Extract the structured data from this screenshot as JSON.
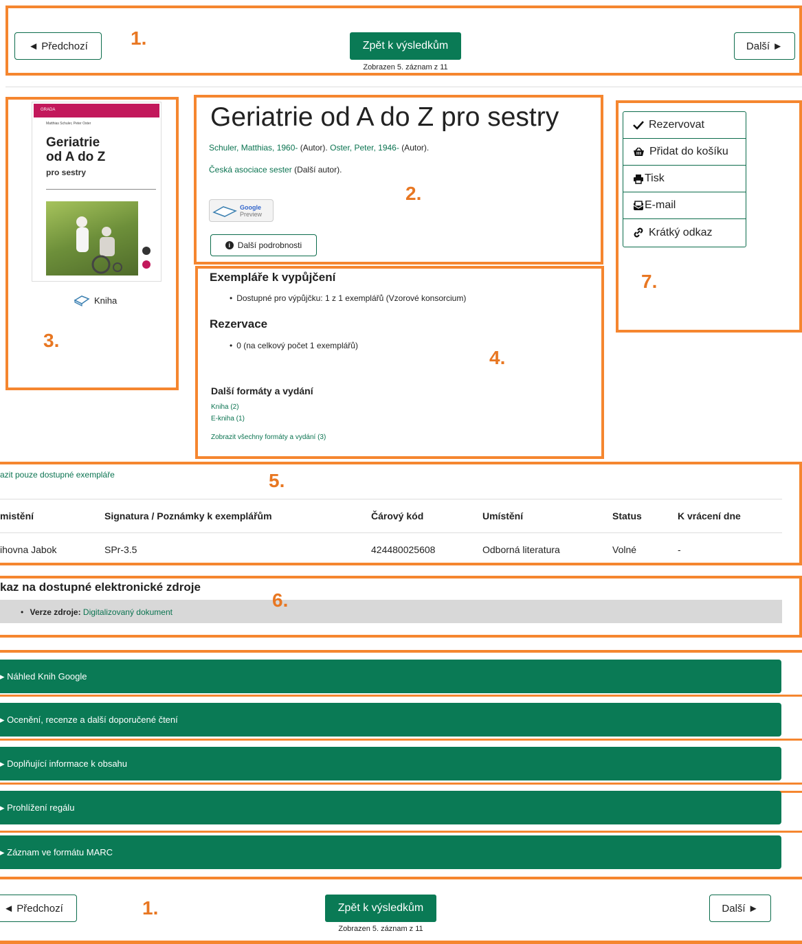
{
  "nav_top": {
    "prev_label": "◄ Předchozí",
    "back_label": "Zpět k výsledkům",
    "next_label": "Další ►",
    "status": "Zobrazen 5. záznam z 11"
  },
  "nav_bottom": {
    "prev_label": "◄ Předchozí",
    "back_label": "Zpět k výsledkům",
    "next_label": "Další ►",
    "status": "Zobrazen 5. záznam z 11"
  },
  "annotations": {
    "n1": "1.",
    "n2": "2.",
    "n3": "3.",
    "n4": "4.",
    "n5": "5.",
    "n6": "6.",
    "n7": "7.",
    "n1b": "1."
  },
  "cover": {
    "authors": "Matthias Schuler, Peter Oster",
    "title_line1": "Geriatrie",
    "title_line2": "od A do Z",
    "subtitle": "pro sestry",
    "publisher": "GRADA",
    "format_label": "Kniha"
  },
  "record": {
    "title": "Geriatrie od A do Z pro sestry",
    "author1": "Schuler, Matthias, 1960-",
    "author1_role": "(Autor).",
    "author2": "Oster, Peter, 1946-",
    "author2_role": "(Autor).",
    "corp_author": "Česká asociace sester",
    "corp_role": "(Další autor).",
    "google_preview_line1": "Google",
    "google_preview_line2": "Preview",
    "more_details": "Další podrobnosti"
  },
  "availability": {
    "heading": "Exempláře k vypůjčení",
    "item": "Dostupné pro výpůjčku: 1 z 1 exemplářů (Vzorové konsorcium)",
    "holds_heading": "Rezervace",
    "holds_item": "0 (na celkový počet 1 exemplářů)",
    "formats_heading": "Další formáty a vydání",
    "format1": "Kniha (2)",
    "format2": "E-kniha (1)",
    "all_formats": "Zobrazit všechny formáty a vydání (3)"
  },
  "actions": [
    {
      "label": "Rezervovat",
      "icon": "check-icon"
    },
    {
      "label": "Přidat do košíku",
      "icon": "basket-icon"
    },
    {
      "label": "Tisk",
      "icon": "print-icon"
    },
    {
      "label": "E-mail",
      "icon": "email-icon"
    },
    {
      "label": "Krátký odkaz",
      "icon": "link-icon"
    }
  ],
  "copies": {
    "filter_link": "azit pouze dostupné exempláře",
    "headers": [
      "mistění",
      "Signatura / Poznámky k exemplářům",
      "Čárový kód",
      "Umístění",
      "Status",
      "K vrácení dne"
    ],
    "rows": [
      [
        "ihovna Jabok",
        "SPr-3.5",
        "424480025608",
        "Odborná literatura",
        "Volné",
        "-"
      ]
    ]
  },
  "electronic": {
    "heading": "kaz na dostupné elektronické zdroje",
    "label": "Verze zdroje:",
    "link": "Digitalizovaný dokument"
  },
  "accordions": [
    "Náhled Knih Google",
    "Ocenění, recenze a další doporučené čtení",
    "Doplňující informace k obsahu",
    "Prohlížení regálu",
    "Záznam ve formátu MARC"
  ],
  "colors": {
    "accent_green": "#0a7a55",
    "annotation_orange": "#f5862f"
  }
}
